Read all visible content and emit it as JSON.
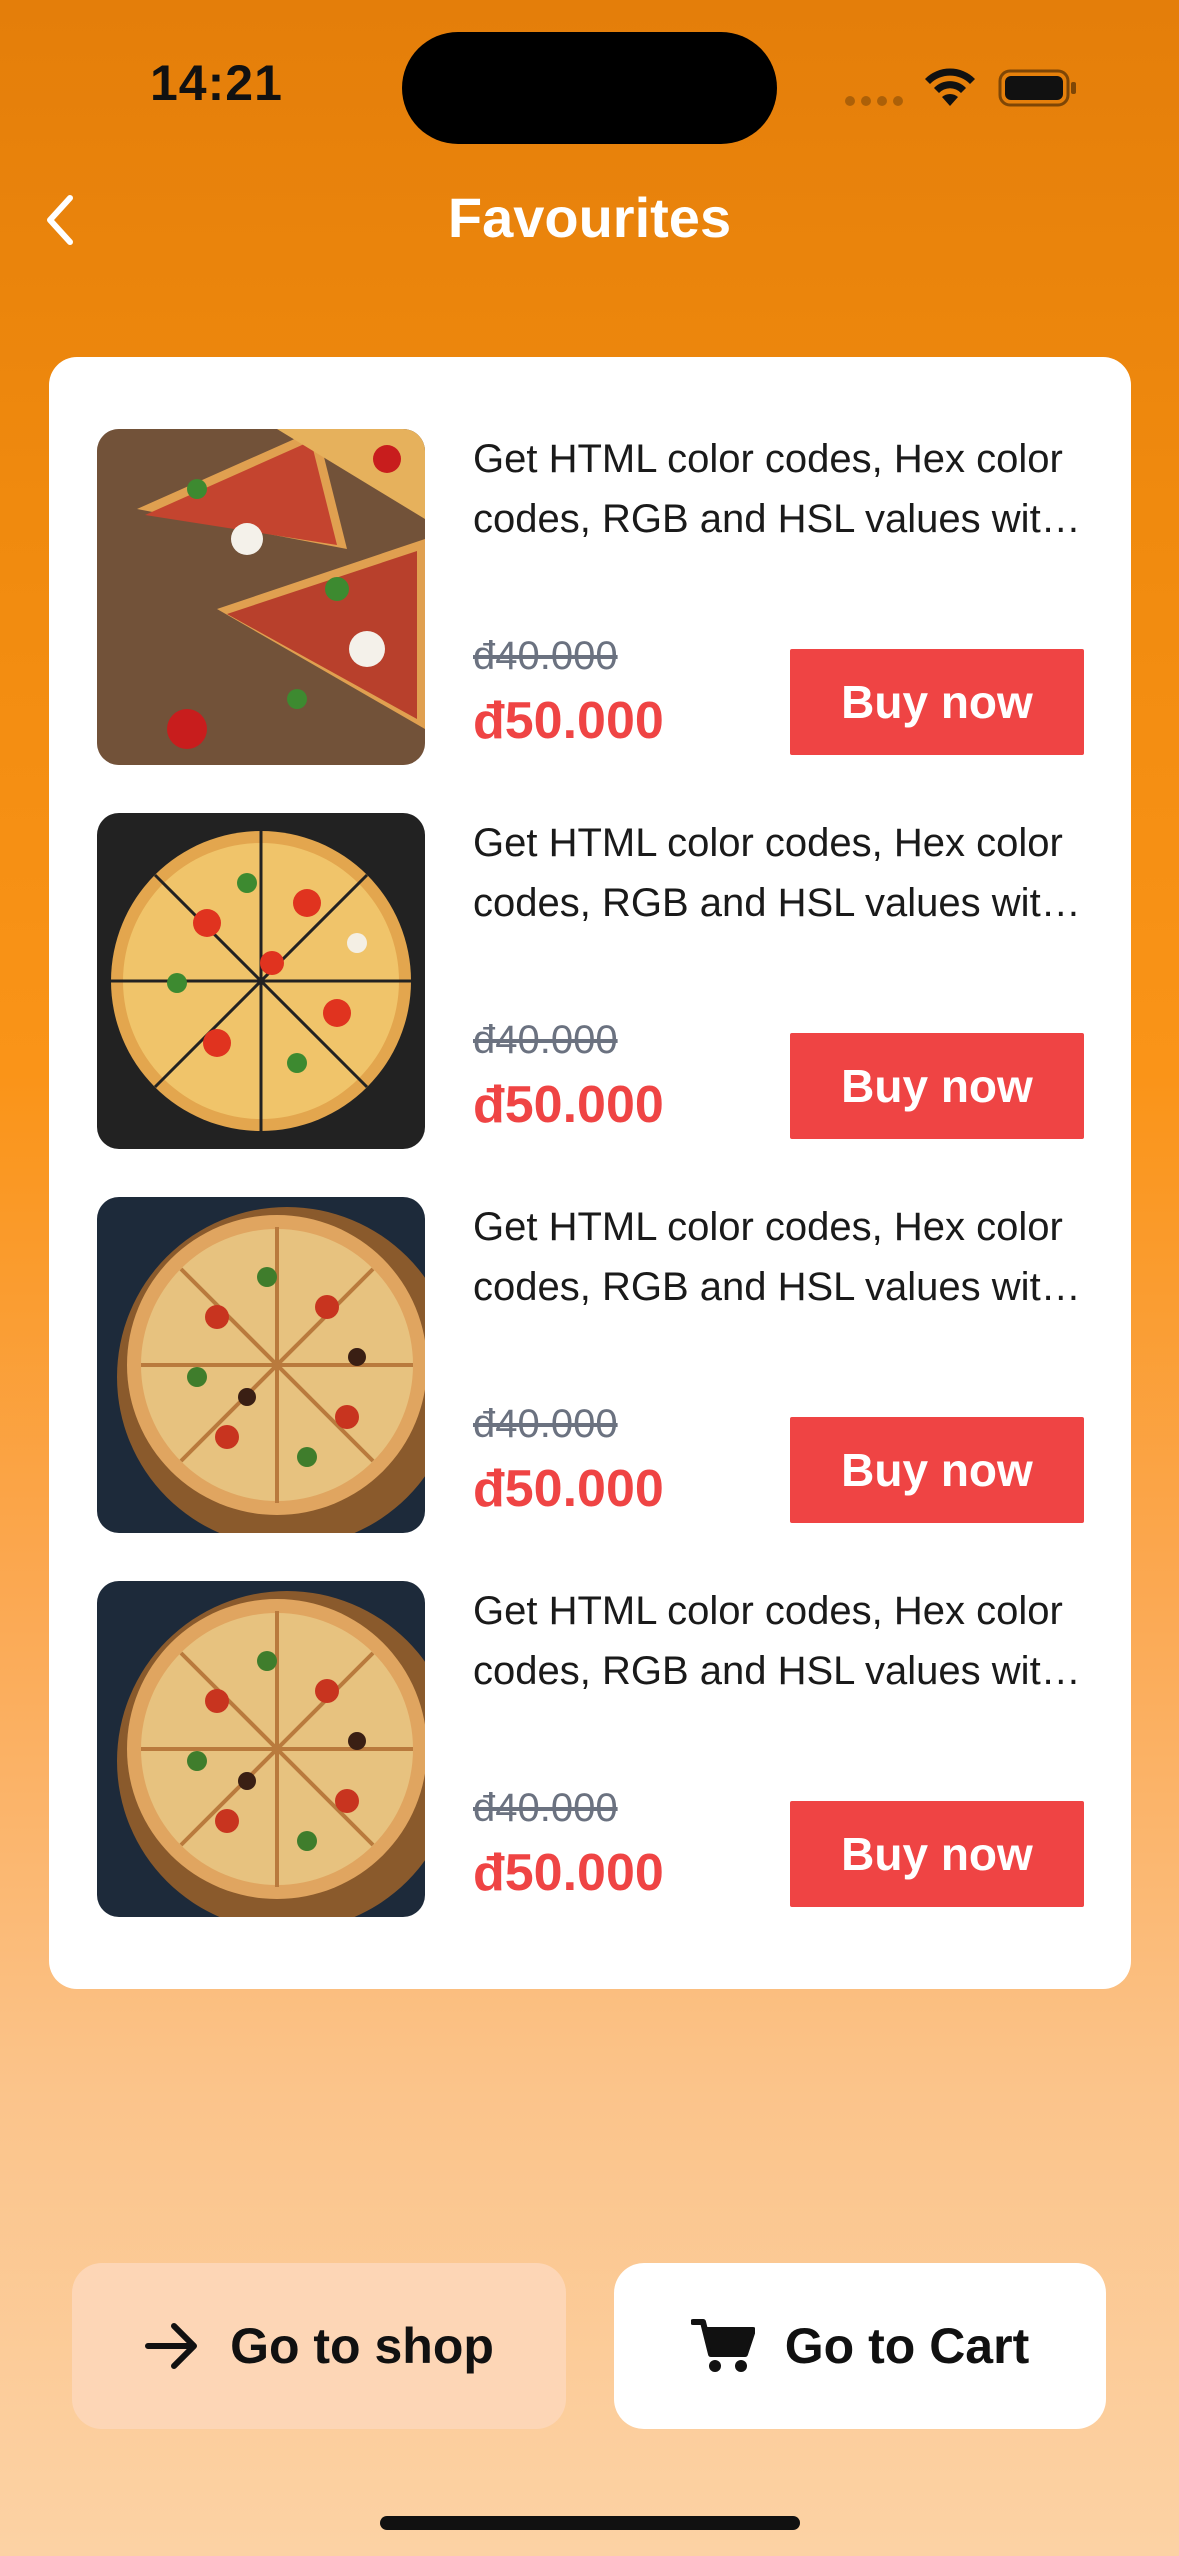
{
  "status_bar": {
    "time": "14:21"
  },
  "header": {
    "title": "Favourites"
  },
  "items": [
    {
      "description": "Get HTML color codes, Hex color codes, RGB and HSL values with our color picker, color chart and HTML color names.",
      "old_price": "đ40.000",
      "price": "đ50.000",
      "buy_label": "Buy now"
    },
    {
      "description": "Get HTML color codes, Hex color codes, RGB and HSL values with our color picker, color chart and HTML color names.",
      "old_price": "đ40.000",
      "price": "đ50.000",
      "buy_label": "Buy now"
    },
    {
      "description": "Get HTML color codes, Hex color codes, RGB and HSL values with our color picker, color chart and HTML color names.",
      "old_price": "đ40.000",
      "price": "đ50.000",
      "buy_label": "Buy now"
    },
    {
      "description": "Get HTML color codes, Hex color codes, RGB and HSL values with our color picker, color chart and HTML color names.",
      "old_price": "đ40.000",
      "price": "đ50.000",
      "buy_label": "Buy now"
    }
  ],
  "footer": {
    "shop_label": "Go to shop",
    "cart_label": "Go to Cart"
  },
  "icons": {
    "back": "chevron-left-icon",
    "shop": "arrow-right-icon",
    "cart": "cart-icon"
  },
  "colors": {
    "accent": "#EF4444",
    "header_orange": "#E47E0A",
    "shop_button_bg": "#FDD6B6"
  }
}
